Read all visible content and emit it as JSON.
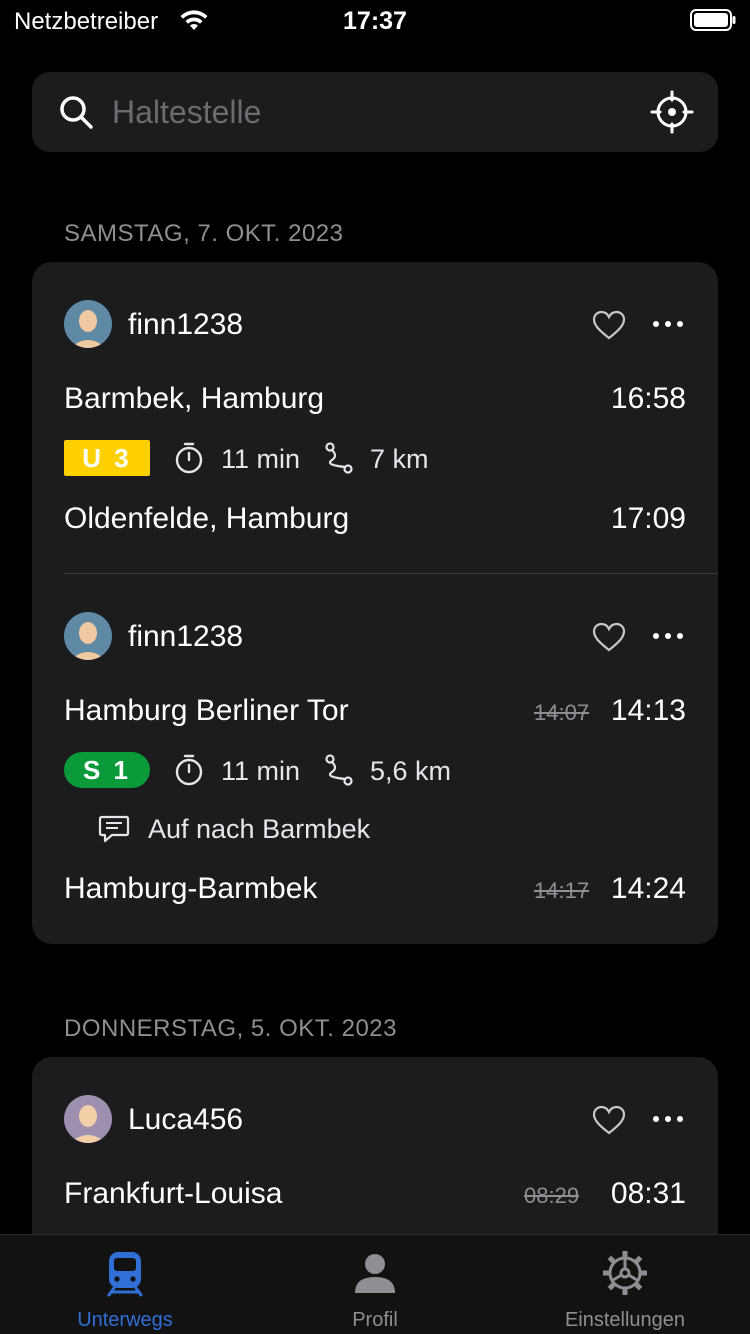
{
  "status_bar": {
    "carrier": "Netzbetreiber",
    "time": "17:37"
  },
  "search": {
    "placeholder": "Haltestelle"
  },
  "sections": [
    {
      "date": "SAMSTAG, 7. OKT. 2023",
      "trips": [
        {
          "user": "finn1238",
          "origin": "Barmbek, Hamburg",
          "departure": "16:58",
          "line": "U 3",
          "line_color": "#ffd000",
          "duration": "11 min",
          "distance": "7 km",
          "destination": "Oldenfelde, Hamburg",
          "arrival": "17:09"
        },
        {
          "user": "finn1238",
          "origin": "Hamburg Berliner Tor",
          "departure_planned": "14:07",
          "departure": "14:13",
          "line": "S 1",
          "line_color": "#0a9a3a",
          "duration": "11 min",
          "distance": "5,6 km",
          "comment": "Auf nach Barmbek",
          "destination": "Hamburg-Barmbek",
          "arrival_planned": "14:17",
          "arrival": "14:24"
        }
      ]
    },
    {
      "date": "DONNERSTAG, 5. OKT. 2023",
      "trips": [
        {
          "user": "Luca456",
          "origin": "Frankfurt-Louisa",
          "departure_planned": "08:29",
          "departure": "08:31"
        }
      ]
    }
  ],
  "tab_bar": {
    "tabs": [
      {
        "label": "Unterwegs",
        "icon": "train-icon",
        "active": true
      },
      {
        "label": "Profil",
        "icon": "person-icon",
        "active": false
      },
      {
        "label": "Einstellungen",
        "icon": "gear-icon",
        "active": false
      }
    ],
    "active_color": "#2f6fd6"
  }
}
